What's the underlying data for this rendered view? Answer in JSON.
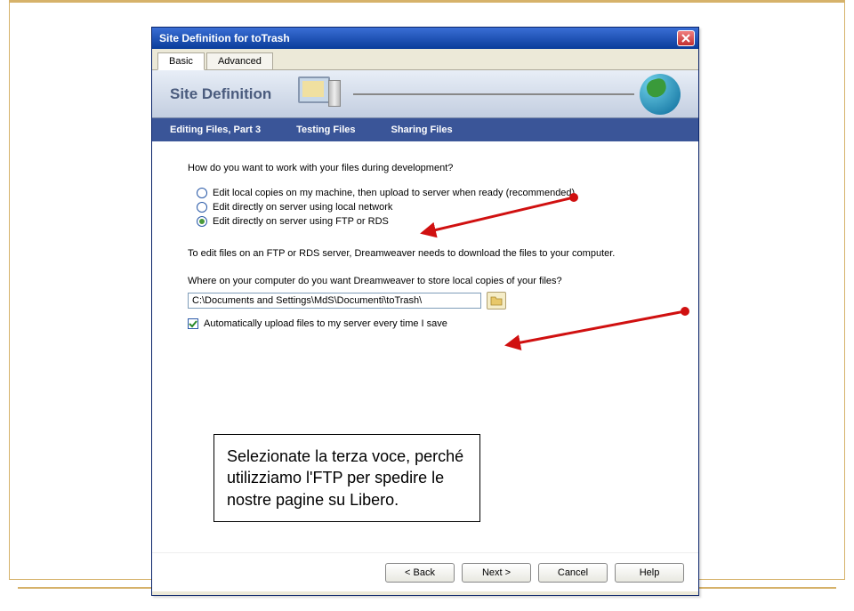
{
  "window": {
    "title": "Site Definition for toTrash"
  },
  "tabs": {
    "basic": "Basic",
    "advanced": "Advanced"
  },
  "header": {
    "title": "Site Definition"
  },
  "nav": {
    "item1": "Editing Files, Part 3",
    "item2": "Testing Files",
    "item3": "Sharing Files"
  },
  "content": {
    "question1": "How do you want to work with your files during development?",
    "radio1": "Edit local copies on my machine, then upload to server when ready (recommended)",
    "radio2": "Edit directly on server using local network",
    "radio3": "Edit directly on server using FTP or RDS",
    "note": "To edit files on an FTP or RDS server, Dreamweaver needs to download the files to your computer.",
    "question2": "Where on your computer do you want Dreamweaver to store local copies of your files?",
    "path": "C:\\Documents and Settings\\MdS\\Documenti\\toTrash\\",
    "checkbox_label": "Automatically upload files to my server every time I save"
  },
  "buttons": {
    "back": "< Back",
    "next": "Next >",
    "cancel": "Cancel",
    "help": "Help"
  },
  "callout": {
    "text": "Selezionate la terza voce, perché utilizziamo l'FTP per spedire le nostre pagine su Libero."
  }
}
